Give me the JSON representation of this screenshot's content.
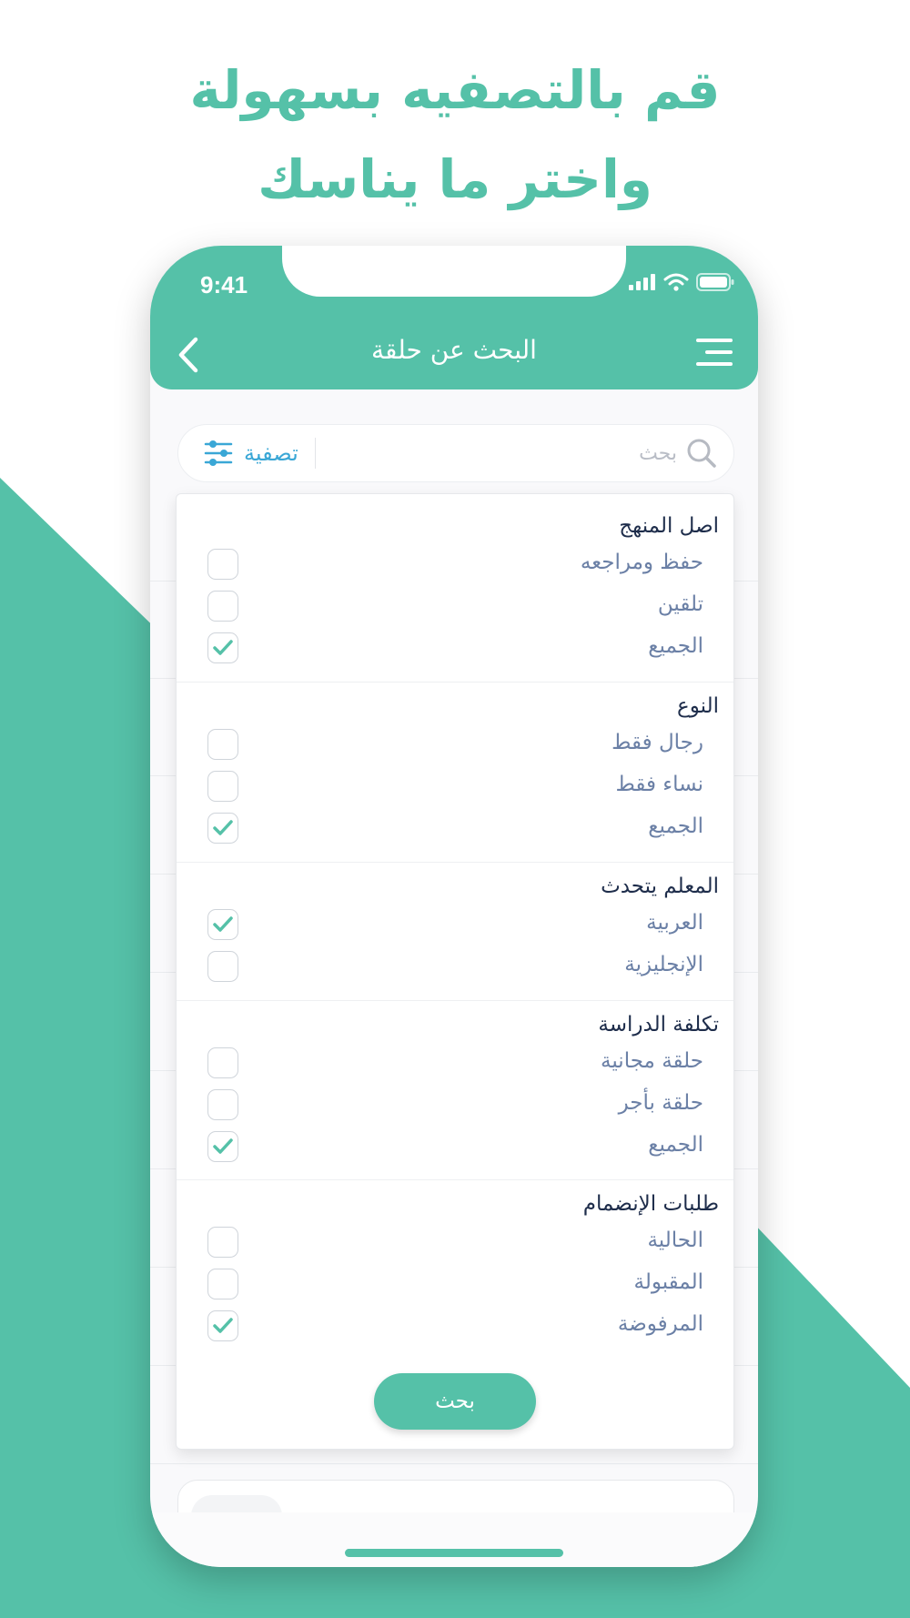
{
  "promo": {
    "line1": "قم بالتصفيه بسهولة",
    "line2": "واختر ما يناسك"
  },
  "colors": {
    "accent": "#55c1a8",
    "filter_link": "#3aa7d6",
    "title_text": "#1e2d4b",
    "option_text": "#6b80a6"
  },
  "status_bar": {
    "time": "9:41",
    "icons": [
      "signal-icon",
      "wifi-icon",
      "battery-icon"
    ]
  },
  "nav": {
    "title": "البحث عن حلقة",
    "back_icon": "chevron-left-icon",
    "menu_icon": "menu-icon"
  },
  "search": {
    "placeholder": "بحث",
    "filter_label": "تصفية",
    "filter_icon": "sliders-icon"
  },
  "filters": {
    "sections": [
      {
        "title": "اصل المنهج",
        "options": [
          {
            "label": "حفظ ومراجعه",
            "checked": false
          },
          {
            "label": "تلقين",
            "checked": false
          },
          {
            "label": "الجميع",
            "checked": true
          }
        ]
      },
      {
        "title": "النوع",
        "options": [
          {
            "label": "رجال فقط",
            "checked": false
          },
          {
            "label": "نساء فقط",
            "checked": false
          },
          {
            "label": "الجميع",
            "checked": true
          }
        ]
      },
      {
        "title": "المعلم يتحدث",
        "options": [
          {
            "label": "العربية",
            "checked": true
          },
          {
            "label": "الإنجليزية",
            "checked": false
          }
        ]
      },
      {
        "title": "تكلفة الدراسة",
        "options": [
          {
            "label": "حلقة مجانية",
            "checked": false
          },
          {
            "label": "حلقة بأجر",
            "checked": false
          },
          {
            "label": "الجميع",
            "checked": true
          }
        ]
      },
      {
        "title": "طلبات الإنضمام",
        "options": [
          {
            "label": "الحالية",
            "checked": false
          },
          {
            "label": "المقبولة",
            "checked": false
          },
          {
            "label": "المرفوضة",
            "checked": true
          }
        ]
      }
    ],
    "submit_label": "بحث"
  }
}
